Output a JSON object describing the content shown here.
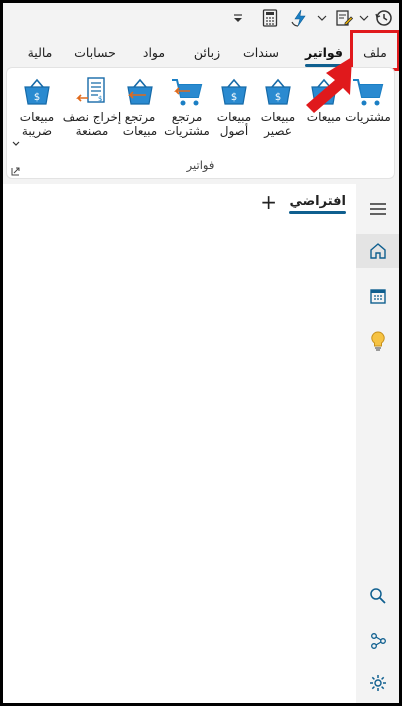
{
  "quick_access": {
    "icons": [
      "history-icon",
      "chevron-down-icon",
      "edit-document-icon",
      "chevron-down-icon",
      "flash-sync-icon",
      "calculator-icon",
      "dropdown-caret-icon"
    ]
  },
  "tabs": [
    {
      "label": "ملف",
      "active": false,
      "highlighted": true
    },
    {
      "label": "فواتير",
      "active": true
    },
    {
      "label": "سندات",
      "active": false
    },
    {
      "label": "زبائن",
      "active": false
    },
    {
      "label": "مواد",
      "active": false
    },
    {
      "label": "حسابات",
      "active": false
    },
    {
      "label": "مالية",
      "active": false
    }
  ],
  "ribbon": {
    "group_label": "فواتير",
    "buttons": [
      {
        "label": "مشتريات",
        "icon": "cart-icon"
      },
      {
        "label": "مبيعات",
        "icon": "basket-icon"
      },
      {
        "label": "مبيعات\nعصير",
        "icon": "basket-icon"
      },
      {
        "label": "مبيعات\nأصول",
        "icon": "basket-icon"
      },
      {
        "label": "مرتجع\nمشتريات",
        "icon": "cart-return-icon"
      },
      {
        "label": "مرتجع\nمبيعات",
        "icon": "basket-return-icon"
      },
      {
        "label": "إخراج نصف\nمصنعة",
        "icon": "invoice-output-icon"
      },
      {
        "label": "مبيعات\nضريبة",
        "icon": "basket-icon",
        "has_dropdown": true
      }
    ]
  },
  "document": {
    "tab_label": "افتراضي",
    "add_label": "+"
  },
  "sidebar": {
    "items": [
      "menu-icon",
      "home-icon",
      "calendar-icon",
      "lightbulb-icon",
      "search-icon",
      "share-icon",
      "settings-icon"
    ]
  },
  "colors": {
    "accent": "#0f5f8f",
    "icon_blue": "#1b7fc4",
    "highlight_red": "#e0191c"
  }
}
